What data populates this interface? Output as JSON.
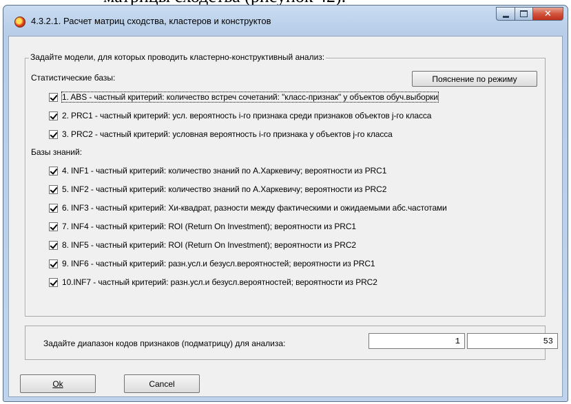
{
  "window": {
    "title": "4.3.2.1. Расчет матриц сходства, кластеров и конструктов"
  },
  "group": {
    "label": "Задайте модели, для которых проводить кластерно-конструктивный анализ:"
  },
  "stat_section": {
    "label": "Статистические базы:",
    "explain_button": "Пояснение по режиму",
    "items": [
      {
        "label": "1. ABS  - частный критерий: количество встреч сочетаний: \"класс-признак\" у объектов обуч.выборки",
        "checked": true
      },
      {
        "label": "2. PRC1 - частный критерий: усл. вероятность i-го признака среди признаков объектов j-го класса",
        "checked": true
      },
      {
        "label": "3. PRC2 - частный критерий: условная вероятность i-го признака у объектов j-го класса",
        "checked": true
      }
    ]
  },
  "knowledge_section": {
    "label": "Базы знаний:",
    "items": [
      {
        "label": "4. INF1 - частный критерий: количество знаний по А.Харкевичу; вероятности из PRC1",
        "checked": true
      },
      {
        "label": "5. INF2 - частный критерий: количество знаний по А.Харкевичу; вероятности из PRC2",
        "checked": true
      },
      {
        "label": "6. INF3 - частный критерий: Хи-квадрат, разности между фактическими и ожидаемыми абс.частотами",
        "checked": true
      },
      {
        "label": "7. INF4 - частный критерий: ROI (Return On Investment); вероятности из PRC1",
        "checked": true
      },
      {
        "label": "8. INF5 - частный критерий: ROI (Return On Investment); вероятности из PRC2",
        "checked": true
      },
      {
        "label": "9. INF6 - частный критерий: разн.усл.и безусл.вероятностей; вероятности из PRC1",
        "checked": true
      },
      {
        "label": "10.INF7 - частный критерий: разн.усл.и безусл.вероятностей; вероятности из PRC2",
        "checked": true
      }
    ]
  },
  "range": {
    "label": "Задайте диапазон кодов признаков (подматрицу) для анализа:",
    "from": "1",
    "to": "53"
  },
  "buttons": {
    "ok": "Ok",
    "cancel": "Cancel"
  }
}
